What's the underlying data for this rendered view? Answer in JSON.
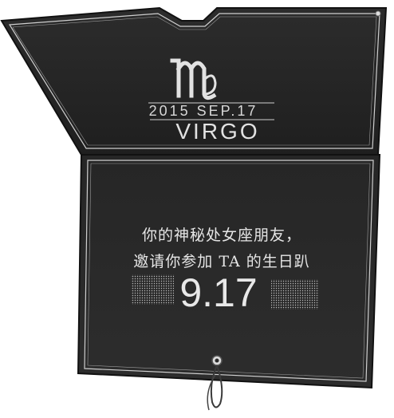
{
  "card": {
    "sign_symbol": "virgo-symbol-icon",
    "date_line": "2015  SEP.17",
    "sign_name": "VIRGO",
    "invitation_line_1": "你的神秘处女座朋友，",
    "invitation_line_2": "邀请你参加 TA 的生日趴",
    "big_date": "9.17"
  },
  "colors": {
    "card": "#2a2a2a",
    "border": "#cfcfcf",
    "text": "#e0e0e0",
    "background": "#ffffff"
  }
}
